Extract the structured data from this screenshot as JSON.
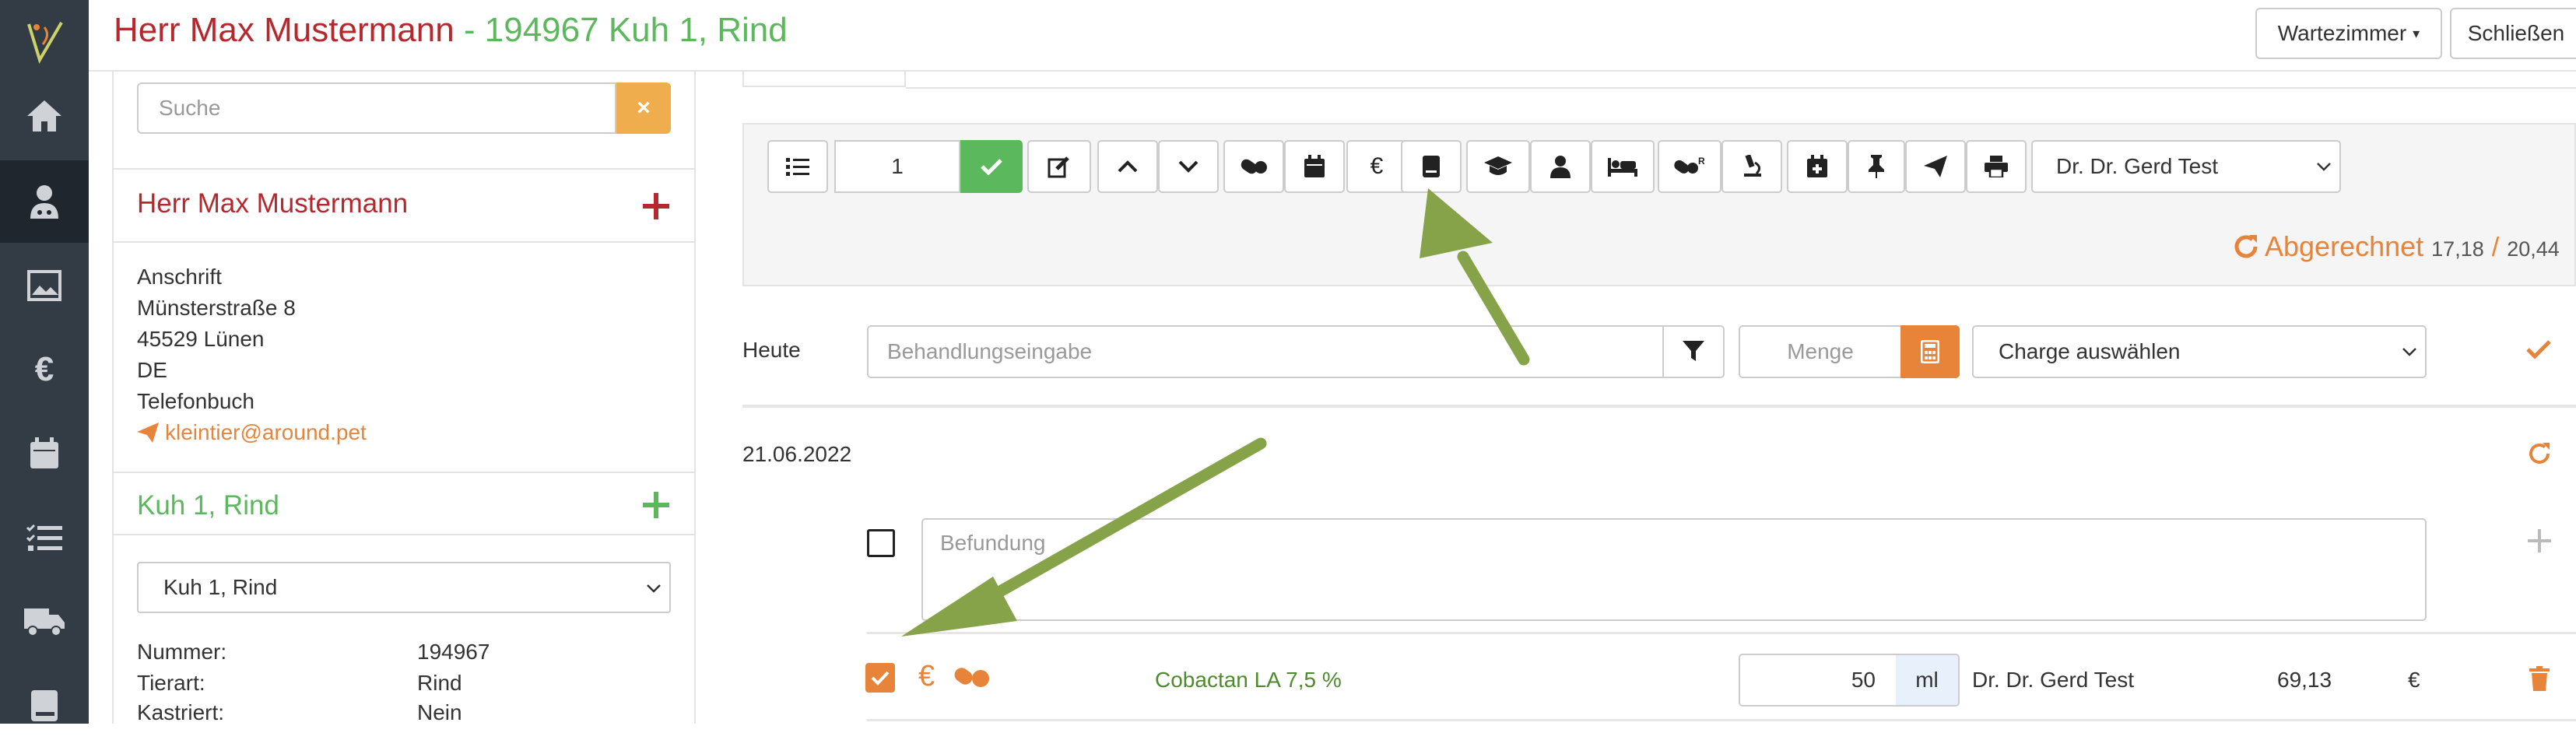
{
  "header": {
    "title_name": "Herr Max Mustermann",
    "title_patient": " - 194967 Kuh 1, Rind",
    "waiting_room_label": "Wartezimmer",
    "close_label": "Schließen"
  },
  "colors": {
    "rail_bg": "#333b45",
    "owner_red": "#b5282d",
    "animal_green": "#5cb85c",
    "accent_orange": "#e8833a",
    "confirm_green": "#5cb85c",
    "drug_name_green": "#4f8a2e",
    "arrow_green": "#86a34a"
  },
  "nav_rail": {
    "items": [
      {
        "icon": "home-icon"
      },
      {
        "icon": "patient-icon",
        "active": true
      },
      {
        "icon": "monitor-image-icon"
      },
      {
        "icon": "euro-icon"
      },
      {
        "icon": "calendar-icon"
      },
      {
        "icon": "checklist-icon"
      },
      {
        "icon": "truck-icon"
      },
      {
        "icon": "book-icon"
      }
    ]
  },
  "sidebar": {
    "search_placeholder": "Suche",
    "owner_name": "Herr Max Mustermann",
    "address_label": "Anschrift",
    "street": "Münsterstraße 8",
    "city": "45529  Lünen",
    "country": "DE",
    "phonebook_label": "Telefonbuch",
    "email": "kleintier@around.pet",
    "animal_title": "Kuh 1, Rind",
    "animal_select": "Kuh 1, Rind",
    "details": [
      {
        "label": "Nummer:",
        "value": "194967"
      },
      {
        "label": "Tierart:",
        "value": "Rind"
      },
      {
        "label": "Kastriert:",
        "value": "Nein"
      }
    ]
  },
  "toolbar": {
    "count_value": "1",
    "vet_select": "Dr. Dr. Gerd Test",
    "billed_label": "Abgerechnet",
    "billed_value_a": "17,18",
    "billed_separator": "/",
    "billed_value_b": "20,44"
  },
  "entry": {
    "today_label": "Heute",
    "treatment_placeholder": "Behandlungseingabe",
    "quantity_placeholder": "Menge",
    "batch_select": "Charge auswählen"
  },
  "record": {
    "date": "21.06.2022",
    "finding_placeholder": "Befundung",
    "item": {
      "drug_name": "Cobactan LA 7,5 %",
      "quantity": "50",
      "unit": "ml",
      "vet": "Dr. Dr. Gerd Test",
      "price": "69,13",
      "currency": "€"
    }
  }
}
